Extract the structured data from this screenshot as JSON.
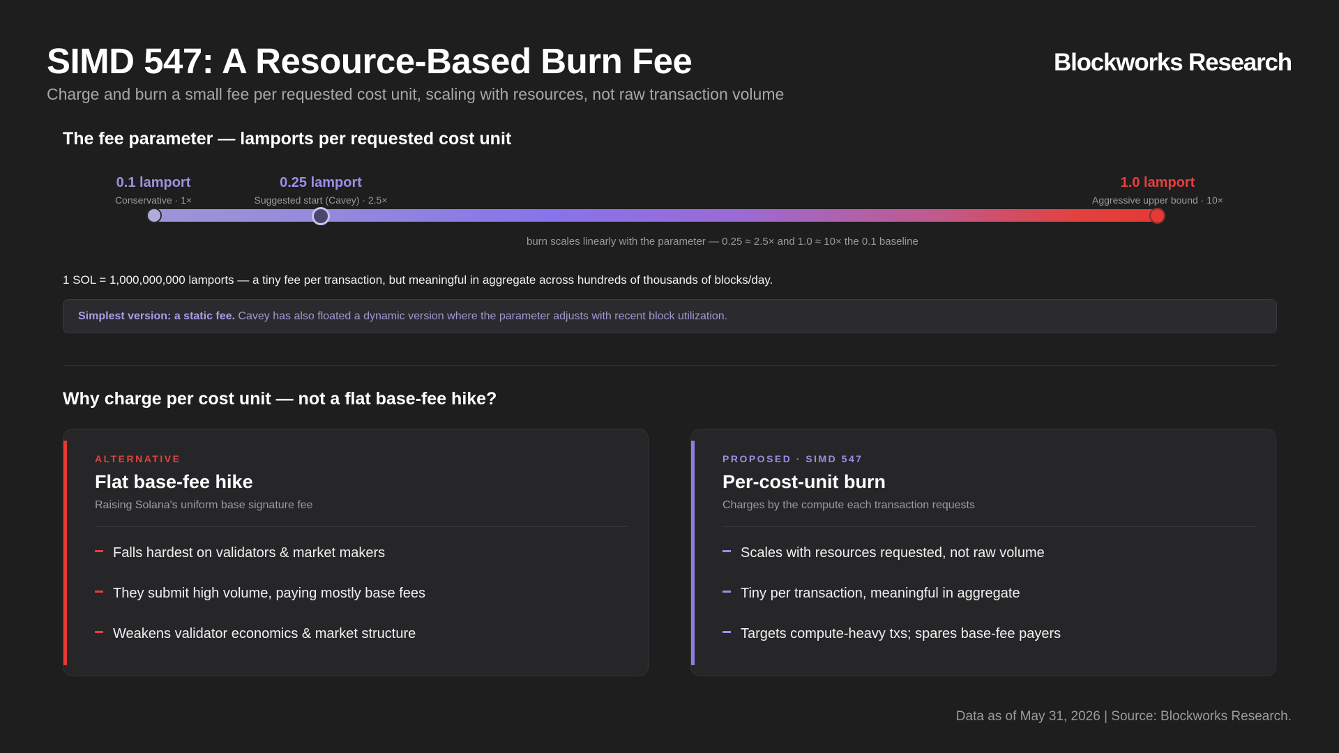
{
  "header": {
    "title": "SIMD 547: A Resource-Based Burn Fee",
    "subtitle": "Charge and burn a small fee per requested cost unit, scaling with resources, not raw transaction volume",
    "brand": "Blockworks Research"
  },
  "fee_section": {
    "heading": "The fee parameter — lamports per requested cost unit",
    "markers": [
      {
        "value": "0.1 lamport",
        "label": "Conservative · 1×"
      },
      {
        "value": "0.25 lamport",
        "label": "Suggested start (Cavey) · 2.5×"
      },
      {
        "value": "1.0 lamport",
        "label": "Aggressive upper bound · 10×"
      }
    ],
    "scale_note": "burn scales linearly with the parameter — 0.25 ≈ 2.5× and 1.0 ≈ 10× the 0.1 baseline",
    "lamport_note": "1 SOL = 1,000,000,000 lamports — a tiny fee per transaction, but meaningful in aggregate across hundreds of thousands of blocks/day.",
    "callout": {
      "bold": "Simplest version: a static fee.",
      "text": " Cavey has also floated a dynamic version where the parameter adjusts with recent block utilization."
    }
  },
  "compare_section": {
    "heading": "Why charge per cost unit — not a flat base-fee hike?",
    "alternative": {
      "kicker": "ALTERNATIVE",
      "title": "Flat base-fee hike",
      "desc": "Raising Solana's uniform base signature fee",
      "items": [
        "Falls hardest on validators & market makers",
        "They submit high volume, paying mostly base fees",
        "Weakens validator economics & market structure"
      ]
    },
    "proposed": {
      "kicker": "PROPOSED · SIMD 547",
      "title": "Per-cost-unit burn",
      "desc": "Charges by the compute each transaction requests",
      "items": [
        "Scales with resources requested, not raw volume",
        "Tiny per transaction, meaningful in aggregate",
        "Targets compute-heavy txs; spares base-fee payers"
      ]
    }
  },
  "footer": "Data as of May 31, 2026 | Source: Blockworks Research.",
  "colors": {
    "background": "#1e1e1f",
    "accent_purple": "#9b8ee8",
    "accent_red": "#e5403c"
  }
}
